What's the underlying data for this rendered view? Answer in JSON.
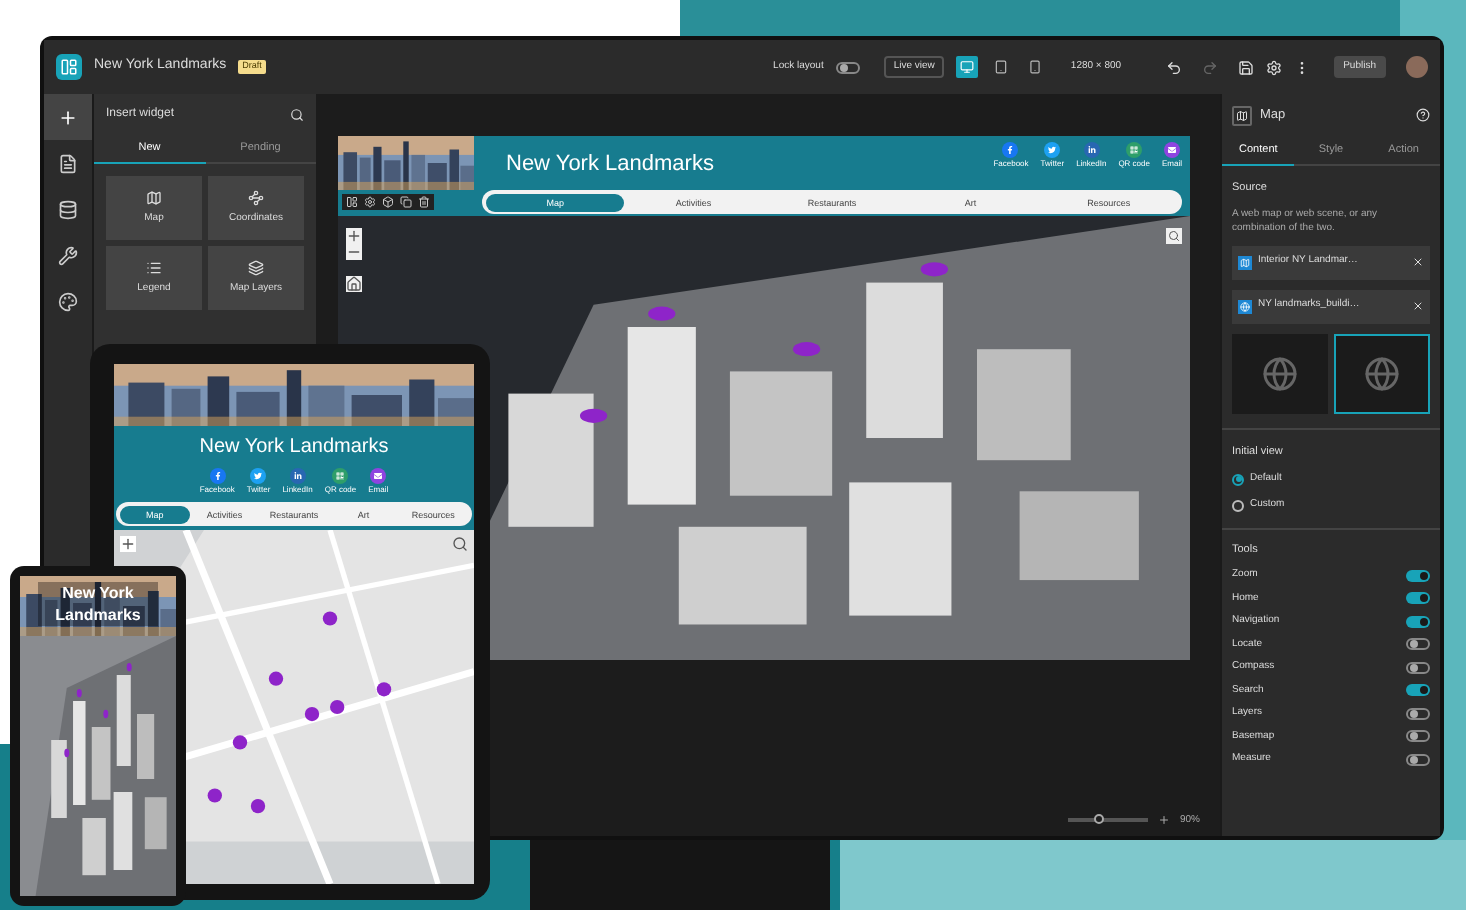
{
  "editor": {
    "title": "New York Landmarks",
    "badge": "Draft",
    "lock_layout": {
      "label": "Lock layout",
      "on": false
    },
    "live_view": "Live view",
    "devices": [
      {
        "kind": "desktop",
        "selected": true
      },
      {
        "kind": "tablet",
        "selected": false
      },
      {
        "kind": "phone",
        "selected": false
      }
    ],
    "resolution": "1280 × 800",
    "publish": "Publish"
  },
  "rail": [
    {
      "kind": "add",
      "selected": true
    },
    {
      "kind": "page",
      "selected": false
    },
    {
      "kind": "data",
      "selected": false
    },
    {
      "kind": "tools",
      "selected": false
    },
    {
      "kind": "theme",
      "selected": false
    }
  ],
  "widget_panel": {
    "title": "Insert widget",
    "tabs": [
      {
        "label": "New",
        "selected": true
      },
      {
        "label": "Pending",
        "selected": false
      }
    ],
    "widgets": [
      {
        "label": "Map",
        "kind": "map"
      },
      {
        "label": "Coordinates",
        "kind": "coordinates"
      },
      {
        "label": "Legend",
        "kind": "legend"
      },
      {
        "label": "Map Layers",
        "kind": "layers"
      }
    ]
  },
  "app": {
    "title": "New York Landmarks",
    "share": [
      {
        "label": "Facebook",
        "kind": "facebook",
        "color": "#1877f2"
      },
      {
        "label": "Twitter",
        "kind": "twitter",
        "color": "#1da1f2"
      },
      {
        "label": "LinkedIn",
        "kind": "linkedin",
        "color": "#2867b2"
      },
      {
        "label": "QR code",
        "kind": "qr",
        "color": "#2e9e6a"
      },
      {
        "label": "Email",
        "kind": "email",
        "color": "#8e44e0"
      }
    ],
    "nav": [
      {
        "label": "Map",
        "selected": true
      },
      {
        "label": "Activities",
        "selected": false
      },
      {
        "label": "Restaurants",
        "selected": false
      },
      {
        "label": "Art",
        "selected": false
      },
      {
        "label": "Resources",
        "selected": false
      }
    ]
  },
  "zoom": "90%",
  "zoom_slider": {
    "level": 0.4
  },
  "settings": {
    "title": "Map",
    "tabs": [
      {
        "label": "Content",
        "selected": true
      },
      {
        "label": "Style",
        "selected": false
      },
      {
        "label": "Action",
        "selected": false
      }
    ],
    "source_heading": "Source",
    "source_hint": "A web map or web scene, or any combination of the two.",
    "sources": [
      {
        "label": "Interior NY Landmar…",
        "kind": "map"
      },
      {
        "label": "NY landmarks_buildi…",
        "kind": "scene"
      }
    ],
    "thumbnails": [
      {
        "selected": false
      },
      {
        "selected": true
      }
    ],
    "initial_view": {
      "heading": "Initial view",
      "options": [
        {
          "label": "Default",
          "selected": true
        },
        {
          "label": "Custom",
          "selected": false
        }
      ]
    },
    "tools": {
      "heading": "Tools",
      "items": [
        {
          "label": "Zoom",
          "on": true
        },
        {
          "label": "Home",
          "on": true
        },
        {
          "label": "Navigation",
          "on": true
        },
        {
          "label": "Locate",
          "on": false
        },
        {
          "label": "Compass",
          "on": false
        },
        {
          "label": "Search",
          "on": true
        },
        {
          "label": "Layers",
          "on": false
        },
        {
          "label": "Basemap",
          "on": false
        },
        {
          "label": "Measure",
          "on": false
        }
      ]
    }
  },
  "tablet": {
    "title": "New York Landmarks",
    "share": [
      {
        "label": "Facebook",
        "kind": "facebook",
        "color": "#1877f2"
      },
      {
        "label": "Twitter",
        "kind": "twitter",
        "color": "#1da1f2"
      },
      {
        "label": "LinkedIn",
        "kind": "linkedin",
        "color": "#2867b2"
      },
      {
        "label": "QR code",
        "kind": "qr",
        "color": "#2e9e6a"
      },
      {
        "label": "Email",
        "kind": "email",
        "color": "#8e44e0"
      }
    ],
    "nav": [
      {
        "label": "Map",
        "selected": true
      },
      {
        "label": "Activities",
        "selected": false
      },
      {
        "label": "Restaurants",
        "selected": false
      },
      {
        "label": "Art",
        "selected": false
      },
      {
        "label": "Resources",
        "selected": false
      }
    ]
  },
  "phone": {
    "title": "New York Landmarks"
  }
}
